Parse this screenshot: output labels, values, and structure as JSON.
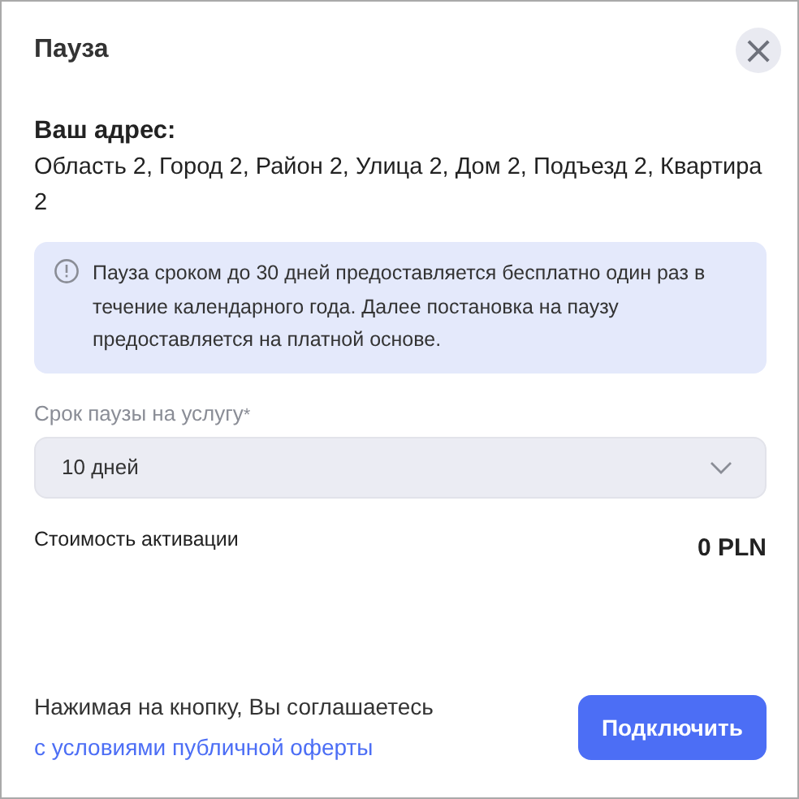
{
  "dialog": {
    "title": "Пауза",
    "close": "×"
  },
  "address": {
    "label": "Ваш адрес:",
    "value": "Область 2, Город 2, Район 2, Улица 2, Дом 2, Подъезд 2, Квартира 2"
  },
  "notice": {
    "text": "Пауза сроком до 30 дней предоставляется бесплатно один раз в течение календарного года. Далее постановка на паузу предоставляется на платной основе."
  },
  "pause_period": {
    "label": "Срок паузы на услугу",
    "required_mark": "*",
    "value": "10 дней"
  },
  "activation_cost": {
    "label": "Стоимость активации",
    "value": "0 PLN"
  },
  "footer": {
    "text": "Нажимая на кнопку, Вы соглашаетесь",
    "link": "с условиями публичной оферты",
    "button": "Подключить"
  }
}
